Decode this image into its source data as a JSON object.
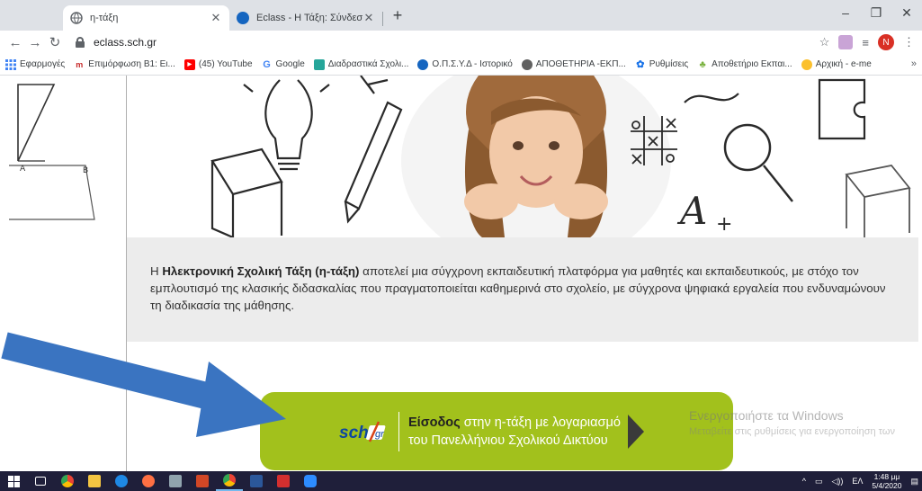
{
  "browser": {
    "tabs": [
      {
        "title": "η-τάξη",
        "active": true
      },
      {
        "title": "Eclass - Η Τάξη: Σύνδεση μαθητ…",
        "active": false
      }
    ],
    "new_tab": "+",
    "url": "eclass.sch.gr",
    "bookmarks": [
      {
        "label": "Εφαρμογές",
        "icon": "apps-grid-icon",
        "color": "#4285f4"
      },
      {
        "label": "Επιμόρφωση Β1: Ει...",
        "icon": "m-logo-icon",
        "color": "#c62828"
      },
      {
        "label": "(45) YouTube",
        "icon": "youtube-icon",
        "color": "#ff0000"
      },
      {
        "label": "Google",
        "icon": "google-icon",
        "color": "#4285f4"
      },
      {
        "label": "Διαδραστικά Σχολι...",
        "icon": "photodentro-icon",
        "color": "#26a69a"
      },
      {
        "label": "Ο.Π.Σ.Υ.Δ - Ιστορικό",
        "icon": "globe-icon",
        "color": "#1565c0"
      },
      {
        "label": "ΑΠΟΘΕΤΗΡΙΑ -ΕΚΠ...",
        "icon": "chrome-globe-icon",
        "color": "#616161"
      },
      {
        "label": "Ρυθμίσεις",
        "icon": "gear-icon",
        "color": "#1a73e8"
      },
      {
        "label": "Αποθετήριο Εκπαι...",
        "icon": "repository-icon",
        "color": "#7cb342"
      },
      {
        "label": "Αρχική - e-me",
        "icon": "e-me-icon",
        "color": "#fbc02d"
      }
    ],
    "bookmarks_more": "»",
    "profile_initial": "N"
  },
  "page": {
    "description_prefix": "Η ",
    "description_bold": "Ηλεκτρονική Σχολική Τάξη (η-τάξη)",
    "description_rest": " αποτελεί μια σύγχρονη εκπαιδευτική πλατφόρμα για μαθητές και εκπαιδευτικούς, με στόχο τον εμπλουτισμό της κλασικής διδασκαλίας που πραγματοποιείται καθημερινά στο σχολείο, με σύγχρονα ψηφιακά εργαλεία που ενδυναμώνουν τη διαδικασία της μάθησης.",
    "login": {
      "logo_text": "sch.gr",
      "bold": "Είσοδος",
      "line1_rest": " στην η-τάξη με λογαριασμό",
      "line2": "του Πανελλήνιου Σχολικού Δικτύου"
    },
    "accent_color": "#a2c11c"
  },
  "windows_watermark": {
    "line1": "Ενεργοποιήστε τα Windows",
    "line2": "Μεταβείτε στις ρυθμίσεις για ενεργοποίηση των"
  },
  "taskbar": {
    "apps": [
      "start-icon",
      "task-view-icon",
      "chrome-icon",
      "file-explorer-icon",
      "edge-icon",
      "paint-icon",
      "mail-icon",
      "powerpoint-icon",
      "chrome-icon",
      "word-icon",
      "acrobat-icon",
      "zoom-icon"
    ],
    "lang": "ΕΛ",
    "time": "1:48 μμ",
    "date": "5/4/2020"
  }
}
